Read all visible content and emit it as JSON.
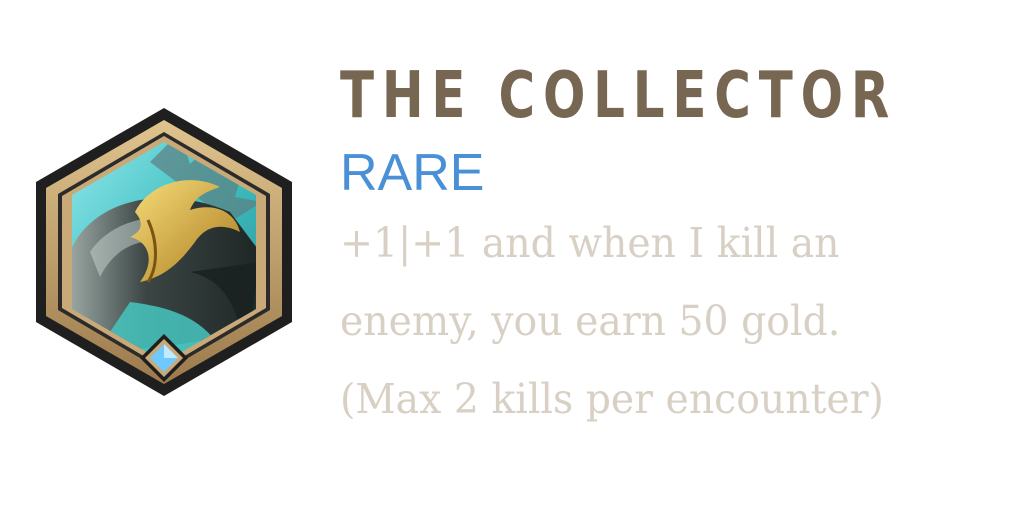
{
  "augment": {
    "title": "THE COLLECTOR",
    "rarity": "RARE",
    "description_lines": [
      "+1|+1 and when I kill an",
      "enemy, you earn 50 gold.",
      "(Max 2 kills per encounter)"
    ],
    "icon": "collector-gauntlet-icon",
    "gem_icon": "diamond-gem-icon"
  },
  "colors": {
    "title": "#776752",
    "rarity": "#4a90d6",
    "description": "#d8d0c4",
    "frame_gold": "#b8976a",
    "frame_dark": "#1f1f1f",
    "inner_teal": "#3fbfc0",
    "gem_blue": "#6fc9ff"
  }
}
